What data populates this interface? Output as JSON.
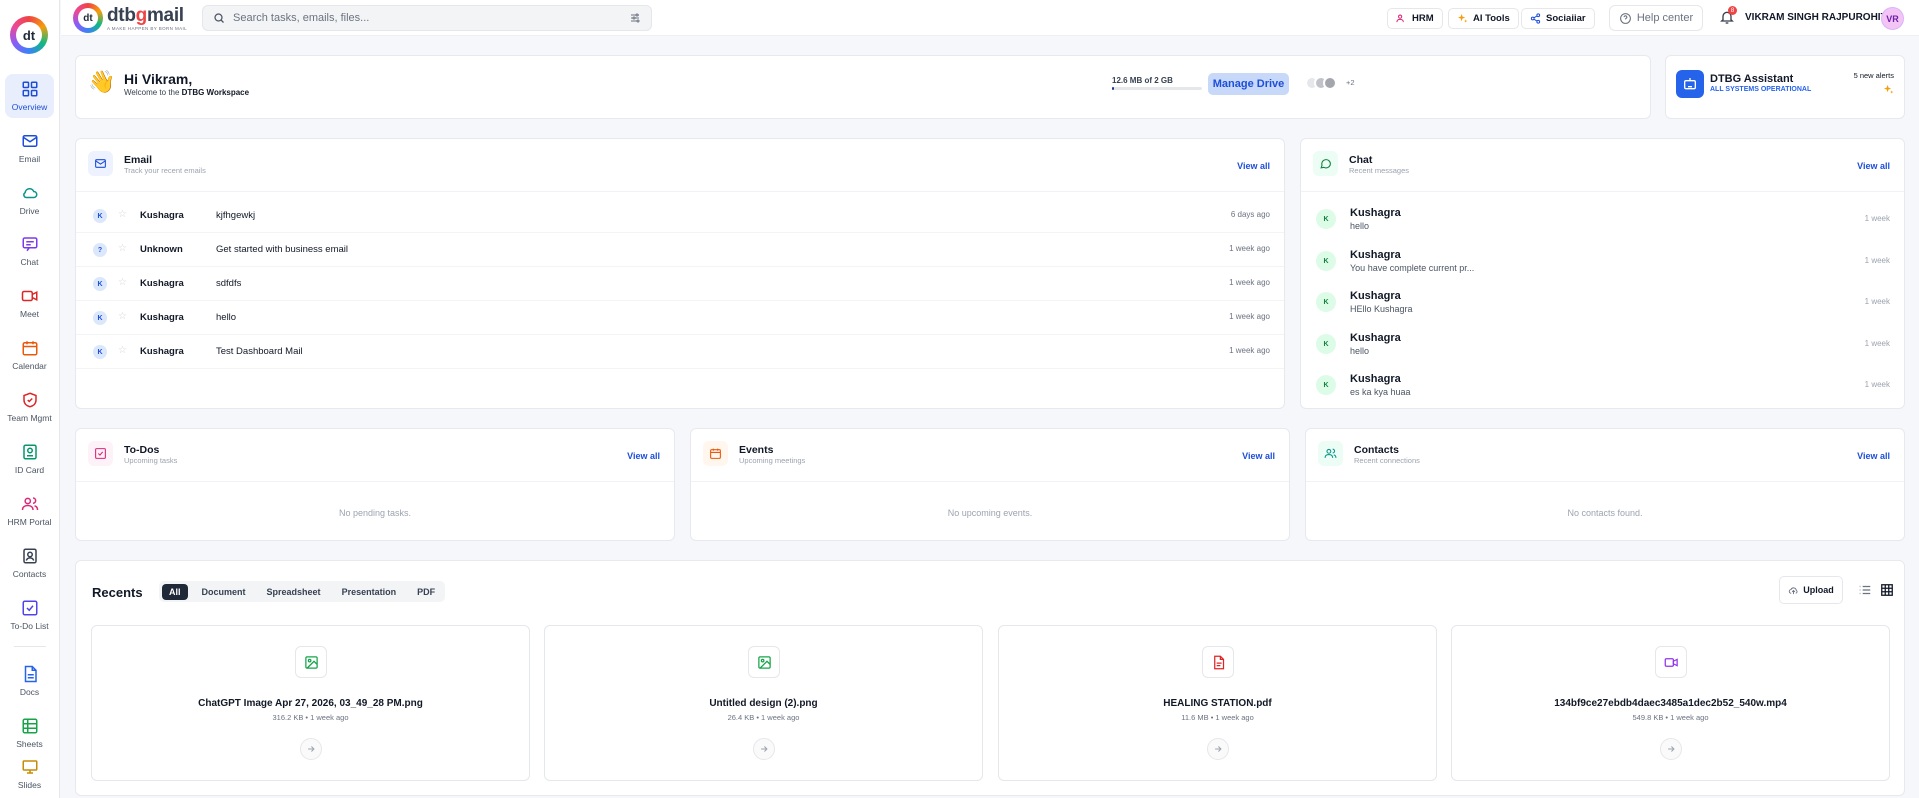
{
  "colors": {
    "accent": "#1d4ed8",
    "active_tab": "#1f2937",
    "alert": "#ef4444"
  },
  "sidebar": {
    "items": [
      {
        "label": "Overview",
        "icon": "grid-icon",
        "color": "#1d4ed8"
      },
      {
        "label": "Email",
        "icon": "mail-icon",
        "color": "#1d4ed8"
      },
      {
        "label": "Drive",
        "icon": "cloud-icon",
        "color": "#0d9488"
      },
      {
        "label": "Chat",
        "icon": "chat-icon",
        "color": "#7c3aed"
      },
      {
        "label": "Meet",
        "icon": "video-icon",
        "color": "#dc2626"
      },
      {
        "label": "Calendar",
        "icon": "calendar-icon",
        "color": "#ea580c"
      },
      {
        "label": "Team Mgmt",
        "icon": "shield-icon",
        "color": "#dc2626"
      },
      {
        "label": "ID Card",
        "icon": "id-card-icon",
        "color": "#059669"
      },
      {
        "label": "HRM Portal",
        "icon": "users-icon",
        "color": "#db2777"
      },
      {
        "label": "Contacts",
        "icon": "contact-icon",
        "color": "#374151"
      },
      {
        "label": "To-Do List",
        "icon": "checkbox-icon",
        "color": "#4f46e5"
      },
      {
        "label": "Docs",
        "icon": "doc-icon",
        "color": "#2563eb"
      },
      {
        "label": "Sheets",
        "icon": "sheet-icon",
        "color": "#16a34a"
      },
      {
        "label": "Slides",
        "icon": "slides-icon",
        "color": "#ca8a04"
      }
    ]
  },
  "header": {
    "brand": {
      "name_part1": "dtb",
      "name_part2": "g",
      "name_part3": "mail",
      "tagline": "A MAKE HAPPEN BY BORN MAIL"
    },
    "search_placeholder": "Search tasks, emails, files...",
    "pills": [
      {
        "label": "HRM",
        "icon": "users-icon"
      },
      {
        "label": "AI Tools",
        "icon": "sparkle-icon"
      },
      {
        "label": "Sociaiiar",
        "icon": "share-icon"
      }
    ],
    "help": "Help center",
    "notifications": "8",
    "user_name": "VIKRAM SINGH RAJPUROHIT",
    "user_initials": "VR"
  },
  "welcome": {
    "greeting": "Hi Vikram,",
    "sub_prefix": "Welcome to the ",
    "sub_bold": "DTBG Workspace",
    "storage": "12.6 MB of 2 GB",
    "storage_fraction": 0.0062,
    "manage_button": "Manage Drive",
    "more_users": "+2"
  },
  "assistant": {
    "title": "DTBG Assistant",
    "status": "ALL SYSTEMS OPERATIONAL",
    "alerts": "5 new alerts"
  },
  "email": {
    "title": "Email",
    "subtitle": "Track your recent emails",
    "view_all": "View all",
    "rows": [
      {
        "initial": "K",
        "from": "Kushagra",
        "subject": "kjfhgewkj",
        "time": "6 days ago"
      },
      {
        "initial": "?",
        "from": "Unknown",
        "subject": "Get started with business email",
        "time": "1 week ago"
      },
      {
        "initial": "K",
        "from": "Kushagra",
        "subject": "sdfdfs",
        "time": "1 week ago"
      },
      {
        "initial": "K",
        "from": "Kushagra",
        "subject": "hello",
        "time": "1 week ago"
      },
      {
        "initial": "K",
        "from": "Kushagra",
        "subject": "Test Dashboard Mail",
        "time": "1 week ago"
      }
    ]
  },
  "chat": {
    "title": "Chat",
    "subtitle": "Recent messages",
    "view_all": "View all",
    "rows": [
      {
        "initial": "K",
        "name": "Kushagra",
        "message": "hello",
        "time": "1 week"
      },
      {
        "initial": "K",
        "name": "Kushagra",
        "message": "You have complete current pr...",
        "time": "1 week"
      },
      {
        "initial": "K",
        "name": "Kushagra",
        "message": "HEllo Kushagra",
        "time": "1 week"
      },
      {
        "initial": "K",
        "name": "Kushagra",
        "message": "hello",
        "time": "1 week"
      },
      {
        "initial": "K",
        "name": "Kushagra",
        "message": "es ka kya huaa",
        "time": "1 week"
      }
    ]
  },
  "todos": {
    "title": "To-Dos",
    "subtitle": "Upcoming tasks",
    "view_all": "View all",
    "empty": "No pending tasks."
  },
  "events": {
    "title": "Events",
    "subtitle": "Upcoming meetings",
    "view_all": "View all",
    "empty": "No upcoming events."
  },
  "contacts": {
    "title": "Contacts",
    "subtitle": "Recent connections",
    "view_all": "View all",
    "empty": "No contacts found."
  },
  "recents": {
    "title": "Recents",
    "tabs": [
      "All",
      "Document",
      "Spreadsheet",
      "Presentation",
      "PDF"
    ],
    "upload": "Upload",
    "files": [
      {
        "name": "ChatGPT Image Apr 27, 2026, 03_49_28 PM.png",
        "meta": "316.2 KB • 1 week ago",
        "icon": "image-icon",
        "color": "#16a34a"
      },
      {
        "name": "Untitled design (2).png",
        "meta": "26.4 KB • 1 week ago",
        "icon": "image-icon",
        "color": "#16a34a"
      },
      {
        "name": "HEALING STATION.pdf",
        "meta": "11.6 MB • 1 week ago",
        "icon": "pdf-icon",
        "color": "#dc2626"
      },
      {
        "name": "134bf9ce27ebdb4daec3485a1dec2b52_540w.mp4",
        "meta": "549.8 KB • 1 week ago",
        "icon": "video-icon",
        "color": "#9333ea"
      }
    ]
  }
}
